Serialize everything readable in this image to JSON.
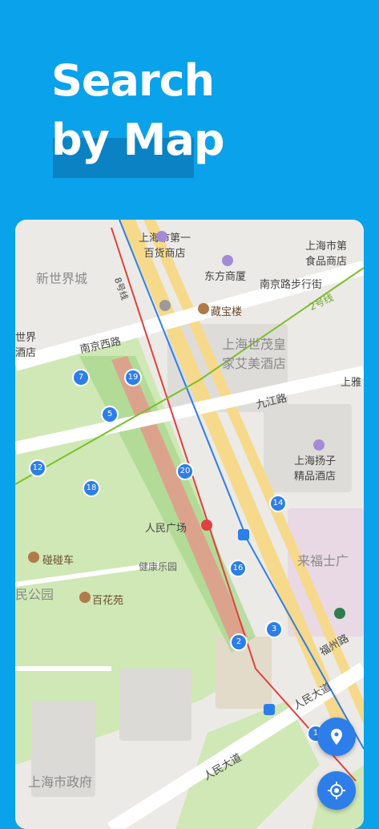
{
  "hero": {
    "line1": "Search",
    "line2": "by Map"
  },
  "map": {
    "labels": {
      "xinshijie": "新世界城",
      "line8": "8号线",
      "line8_top": "线",
      "first_store": "上海市第一\n百货商店",
      "dongfang": "东方商厦",
      "nanjing_walk": "南京路步行街",
      "cangbao": "藏宝楼",
      "line2": "2号线",
      "food_store": "上海市第\n食品商店",
      "world_hotel": "世界\n酒店",
      "nanjing_w": "南京西路",
      "shimao": "上海世茂皇\n家艾美酒店",
      "ya": "上雅",
      "jiujiang": "九江路",
      "yangzi": "上海扬子\n精品酒店",
      "people_square": "人民广场",
      "pengpeng": "碰碰车",
      "jiankang": "健康乐园",
      "park": "民公园",
      "baihua": "百花苑",
      "laifushi": "来福士广",
      "fuzhou": "福州路",
      "renmin1": "人民大道",
      "renmin2": "人民大道",
      "gov": "上海市政府",
      "da": "大"
    },
    "badges": [
      "7",
      "19",
      "5",
      "12",
      "20",
      "18",
      "14",
      "16",
      "3",
      "2",
      "1"
    ]
  },
  "colors": {
    "accent": "#0aa2ea",
    "button": "#2d7ee8"
  }
}
